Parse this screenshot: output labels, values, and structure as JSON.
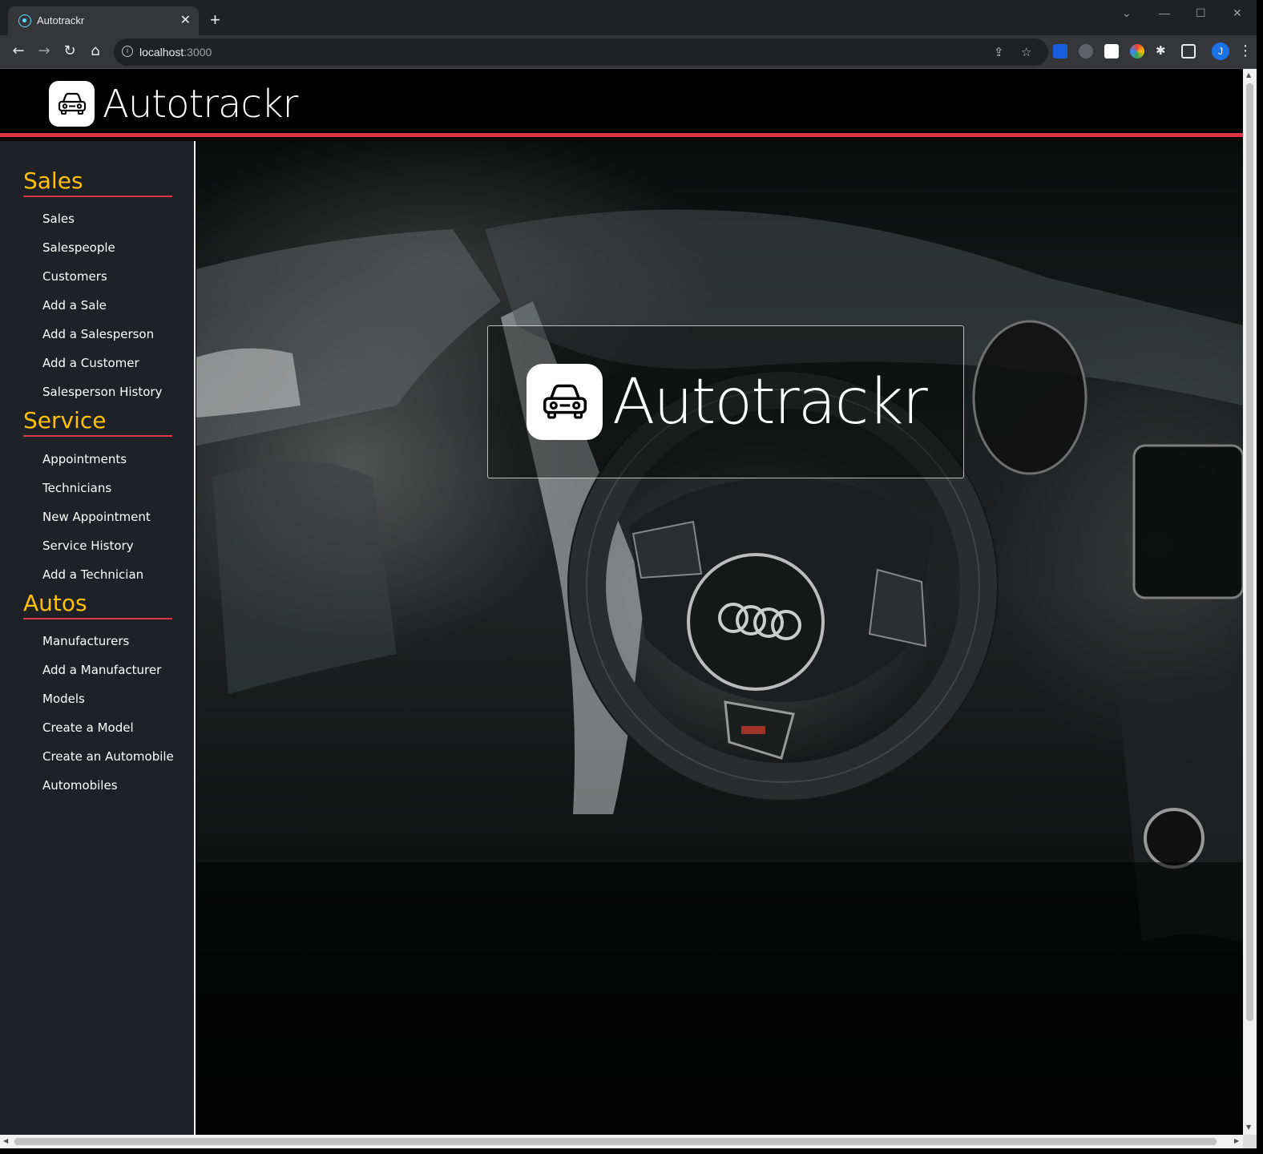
{
  "browser": {
    "tab_title": "Autotrackr",
    "url_host": "localhost",
    "url_port": ":3000",
    "profile_initial": "J"
  },
  "navbar": {
    "brand_text": "Autotrackr"
  },
  "sidebar": {
    "sections": [
      {
        "heading": "Sales",
        "links": [
          "Sales",
          "Salespeople",
          "Customers",
          "Add a Sale",
          "Add a Salesperson",
          "Add a Customer",
          "Salesperson History"
        ]
      },
      {
        "heading": "Service",
        "links": [
          "Appointments",
          "Technicians",
          "New Appointment",
          "Service History",
          "Add a Technician"
        ]
      },
      {
        "heading": "Autos",
        "links": [
          "Manufacturers",
          "Add a Manufacturer",
          "Models",
          "Create a Model",
          "Create an Automobile",
          "Automobiles"
        ]
      }
    ]
  },
  "hero": {
    "title": "Autotrackr"
  },
  "colors": {
    "accent_red": "#dc3545",
    "heading_yellow": "#ffc107",
    "sidebar_bg": "#1e2125"
  },
  "icons": {
    "brand": "car-icon",
    "favicon": "react-icon"
  }
}
